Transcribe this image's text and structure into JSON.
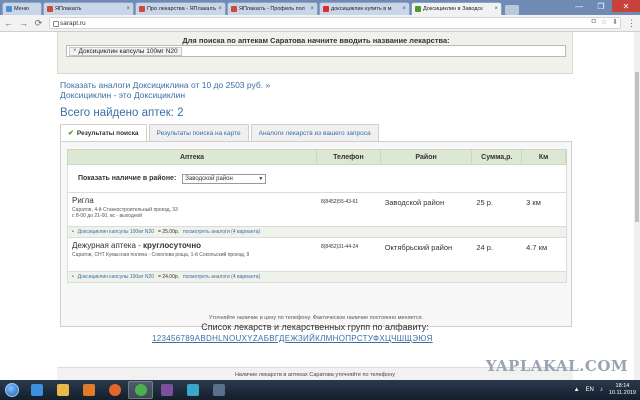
{
  "browser": {
    "tabs": [
      {
        "label": "Меню",
        "favicon": "#4a90d9"
      },
      {
        "label": "ЯПлакалъ",
        "favicon": "#d04a3a"
      },
      {
        "label": "Про лекарства - ЯПлакалъ",
        "favicon": "#d04a3a"
      },
      {
        "label": "ЯПлакалъ - Профиль пол",
        "favicon": "#d04a3a"
      },
      {
        "label": "доксициклин купить в м",
        "favicon": "#e02b2b"
      },
      {
        "label": "Доксициклин в Заводск",
        "favicon": "#4f9a2f"
      }
    ],
    "url": "sarapt.ru",
    "window_controls": [
      "—",
      "❐",
      "✕"
    ]
  },
  "search": {
    "label": "Для поиска по аптекам Саратова начните вводить название лекарства:",
    "chip": "Доксициклин капсулы 100мг N20"
  },
  "links": {
    "analogs": "Показать аналоги Доксициклина от 10 до 2503 руб. »",
    "about": "Доксициклин - это Доксициклин"
  },
  "found": "Всего найдено аптек: 2",
  "tabs": [
    {
      "label": "Результаты поиска",
      "active": true
    },
    {
      "label": "Результаты поиска на карте",
      "active": false
    },
    {
      "label": "Аналоги лекарств из вашего запроса",
      "active": false
    }
  ],
  "table": {
    "headers": [
      "Аптека",
      "Телефон",
      "Район",
      "Сумма,р.",
      "Км"
    ],
    "filter_label": "Показать наличие в районе:",
    "filter_value": "Заводской район",
    "rows": [
      {
        "name": "Ригла",
        "name_suffix": "",
        "address": "Саратов, 4-й Станкостроительный проезд, 33",
        "hours": "с 8-00 до 21-00, вс - выходной",
        "phone": "8(8452)55-43-61",
        "district": "Заводской район",
        "sum": "25 р.",
        "km": "3 км",
        "sub_item": "Доксициклин капсулы 100мг N20",
        "sub_price": "25.00р.",
        "sub_analog": "посмотреть аналоги (4 варианта)"
      },
      {
        "name": "Дежурная аптека",
        "name_suffix": "круглосуточно",
        "address": "Саратов, СНТ Кумысная поляна - Соколова роща, 1-й Сокольский проезд, 9",
        "hours": "",
        "phone": "8(8452)31-44-24",
        "district": "Октябрьский район",
        "sum": "24 р.",
        "km": "4.7 км",
        "sub_item": "Доксициклин капсулы 100мг N20",
        "sub_price": "24.00р.",
        "sub_analog": "посмотреть аналоги (4 варианта)"
      }
    ],
    "note": "Уточняйте наличие и цену по телефону. Фактическое наличие постоянно меняется."
  },
  "alphabet": {
    "title": "Список лекарств и лекарственных групп по алфавиту:",
    "letters": "123456789ABDHLNOUXYZАБВГДЕЖЗИЙКЛМНОПРСТУФХЦЧШЩЭЮЯ"
  },
  "bottom_bar": "Наличие лекарств в аптеках Саратова уточняйте по телефону",
  "watermark": "YAPLAKAL.COM",
  "taskbar": {
    "icons": [
      {
        "name": "ie-icon",
        "color": "#3d8fe0"
      },
      {
        "name": "folder-icon",
        "color": "#e8b84a"
      },
      {
        "name": "media-icon",
        "color": "#e07b2a"
      },
      {
        "name": "firefox-icon",
        "color": "#e5662b"
      },
      {
        "name": "chrome-icon",
        "color": "#4caf50"
      },
      {
        "name": "viber-icon",
        "color": "#7b519d"
      },
      {
        "name": "photo-icon",
        "color": "#3aa6c9"
      },
      {
        "name": "app-icon",
        "color": "#5a6f8c"
      }
    ],
    "lang": "EN",
    "time": "18:14",
    "date": "10.11.2019"
  }
}
